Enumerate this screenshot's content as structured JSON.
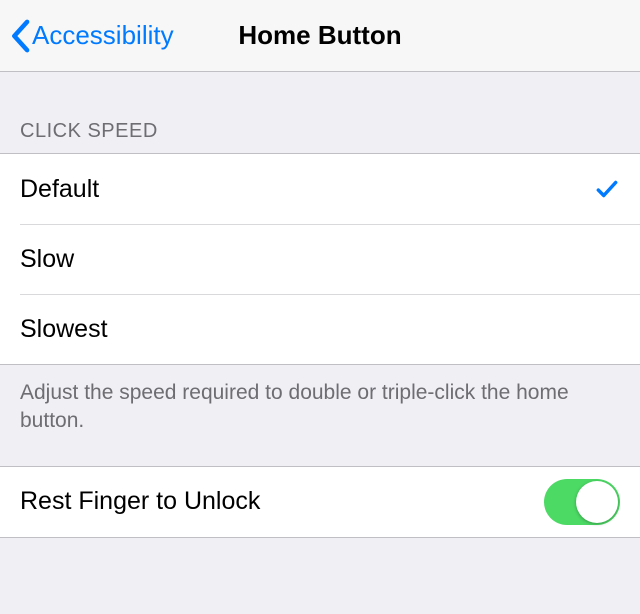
{
  "nav": {
    "back_label": "Accessibility",
    "title": "Home Button"
  },
  "click_speed": {
    "header": "Click Speed",
    "options": [
      {
        "label": "Default",
        "selected": true
      },
      {
        "label": "Slow",
        "selected": false
      },
      {
        "label": "Slowest",
        "selected": false
      }
    ],
    "footer": "Adjust the speed required to double or triple-click the home button."
  },
  "rest_finger": {
    "label": "Rest Finger to Unlock",
    "enabled": true
  },
  "colors": {
    "tint": "#007aff",
    "toggle_on": "#4cd964",
    "background": "#efeff4"
  }
}
